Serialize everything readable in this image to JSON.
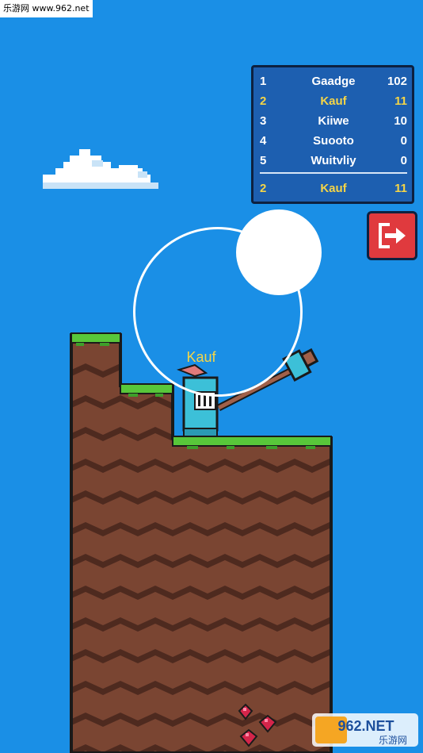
{
  "watermark_top": "乐游网 www.962.net",
  "leaderboard": {
    "rows": [
      {
        "rank": "1",
        "name": "Gaadge",
        "score": "102"
      },
      {
        "rank": "2",
        "name": "Kauf",
        "score": "11"
      },
      {
        "rank": "3",
        "name": "Kiiwe",
        "score": "10"
      },
      {
        "rank": "4",
        "name": "Suooto",
        "score": "0"
      },
      {
        "rank": "5",
        "name": "Wuitvliy",
        "score": "0"
      }
    ],
    "self": {
      "rank": "2",
      "name": "Kauf",
      "score": "11"
    }
  },
  "player": {
    "name": "Kauf"
  },
  "watermark_bottom": {
    "brand": "962.NET",
    "sub": "乐游网"
  },
  "colors": {
    "sky": "#1a8fe6",
    "dirt": "#7a4532",
    "grass": "#58c73a",
    "highlight": "#f5d547",
    "exit": "#e03a3e"
  },
  "icons": {
    "exit": "exit-door-arrow-icon"
  }
}
